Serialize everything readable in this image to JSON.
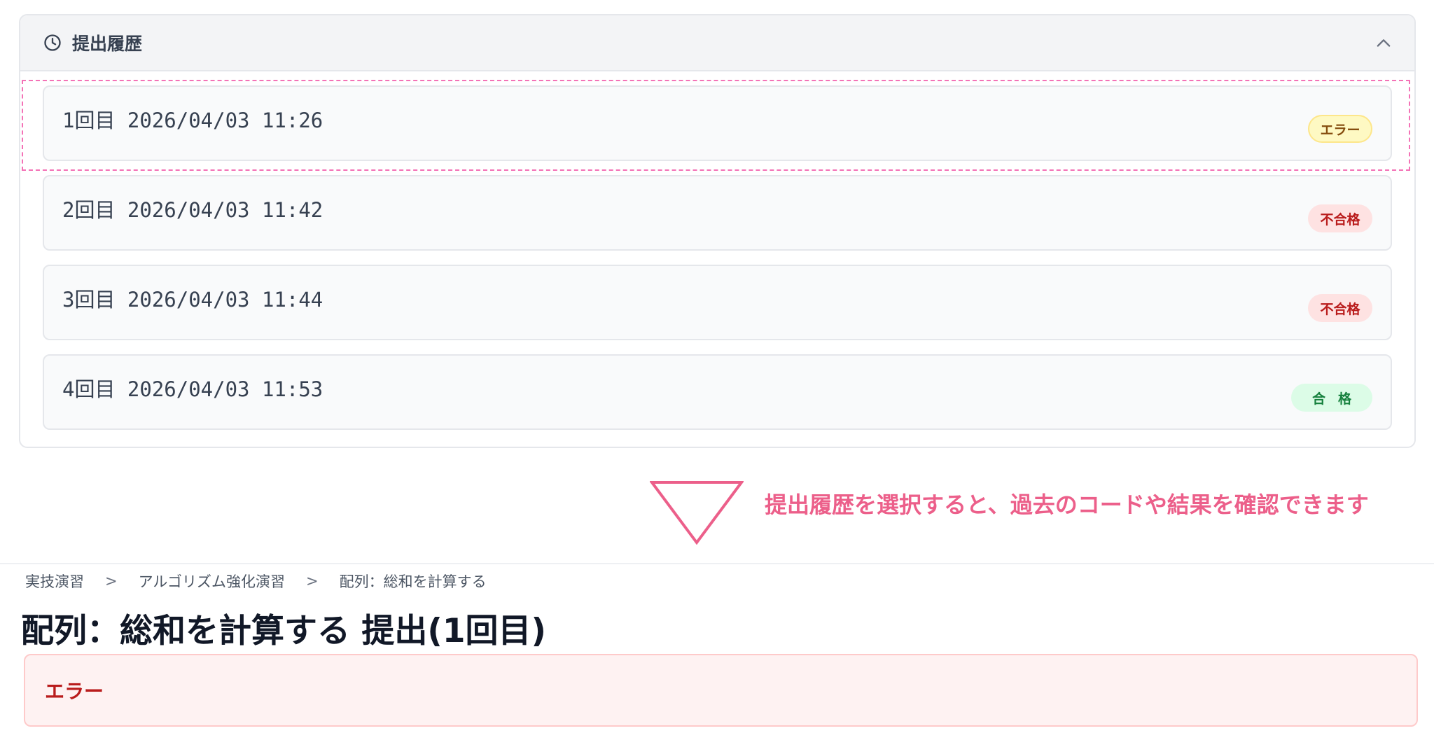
{
  "history": {
    "title": "提出履歴",
    "items": [
      {
        "label": "1回目 2026/04/03 11:26",
        "status": "エラー",
        "status_type": "error",
        "selected": true
      },
      {
        "label": "2回目 2026/04/03 11:42",
        "status": "不合格",
        "status_type": "fail",
        "selected": false
      },
      {
        "label": "3回目 2026/04/03 11:44",
        "status": "不合格",
        "status_type": "fail",
        "selected": false
      },
      {
        "label": "4回目 2026/04/03 11:53",
        "status": "合格",
        "status_type": "pass",
        "selected": false
      }
    ]
  },
  "annotation": {
    "text": "提出履歴を選択すると、過去のコードや結果を確認できます",
    "color": "#ec5f8a"
  },
  "breadcrumb": {
    "items": [
      "実技演習",
      "アルゴリズム強化演習",
      "配列：総和を計算する"
    ],
    "separator": ">"
  },
  "detail": {
    "title": "配列：総和を計算する 提出(1回目)",
    "result_message": "エラー"
  },
  "icons": {
    "history": "clock-icon",
    "collapse": "chevron-up-icon",
    "annotation": "down-triangle-arrow-icon"
  },
  "colors": {
    "error_badge": "#fef9c3",
    "fail_badge": "#fee2e2",
    "pass_badge": "#dcfce7",
    "error_box": "#fef2f2",
    "error_text": "#b91c1c"
  }
}
